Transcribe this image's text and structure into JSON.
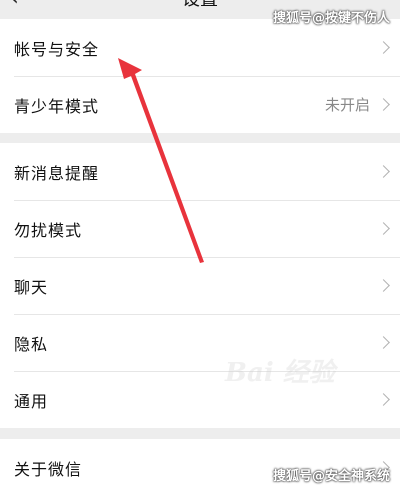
{
  "header": {
    "title": "设置",
    "back_icon": "chevron-left-icon"
  },
  "groups": [
    {
      "items": [
        {
          "label": "帐号与安全",
          "value": ""
        },
        {
          "label": "青少年模式",
          "value": "未开启"
        }
      ]
    },
    {
      "items": [
        {
          "label": "新消息提醒",
          "value": ""
        },
        {
          "label": "勿扰模式",
          "value": ""
        },
        {
          "label": "聊天",
          "value": ""
        },
        {
          "label": "隐私",
          "value": ""
        },
        {
          "label": "通用",
          "value": ""
        }
      ]
    },
    {
      "items": [
        {
          "label": "关于微信",
          "value": ""
        }
      ]
    }
  ],
  "watermarks": {
    "top": "搜狐号@按键不伤人",
    "bottom": "搜狐号@安全神系统",
    "center": "Bai 经验"
  },
  "annotation": {
    "arrow_color": "#e8333c"
  }
}
